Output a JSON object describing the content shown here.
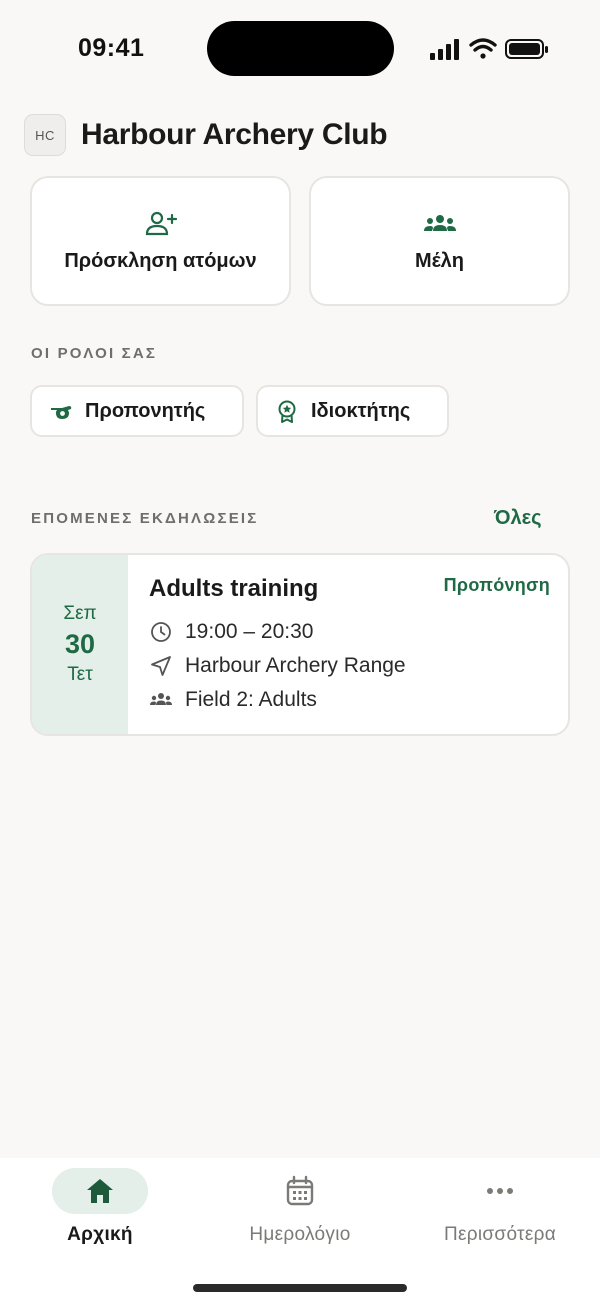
{
  "status_bar": {
    "time": "09:41"
  },
  "club": {
    "initials": "HC",
    "name": "Harbour Archery Club"
  },
  "actions": {
    "invite_label": "Πρόσκληση ατόμων",
    "members_label": "Μέλη"
  },
  "roles": {
    "section_label": "ΟΙ ΡΟΛΟΙ ΣΑΣ",
    "items": [
      {
        "label": "Προπονητής",
        "icon": "whistle-icon"
      },
      {
        "label": "Ιδιοκτήτης",
        "icon": "award-badge-icon"
      }
    ]
  },
  "events": {
    "section_label": "ΕΠΟΜΕΝΕΣ ΕΚΔΗΛΩΣΕΙΣ",
    "see_all": "Όλες",
    "items": [
      {
        "month": "Σεπ",
        "day": "30",
        "weekday": "Τετ",
        "title": "Adults training",
        "type": "Προπόνηση",
        "time": "19:00 – 20:30",
        "location": "Harbour Archery Range",
        "group": "Field 2: Adults"
      }
    ]
  },
  "tabs": [
    {
      "label": "Αρχική",
      "icon": "home-icon",
      "active": true
    },
    {
      "label": "Ημερολόγιο",
      "icon": "calendar-icon",
      "active": false
    },
    {
      "label": "Περισσότερα",
      "icon": "more-dots-icon",
      "active": false
    }
  ],
  "colors": {
    "accent": "#1f6a45",
    "accent_soft": "#e3efe8",
    "background": "#f9f8f6"
  }
}
